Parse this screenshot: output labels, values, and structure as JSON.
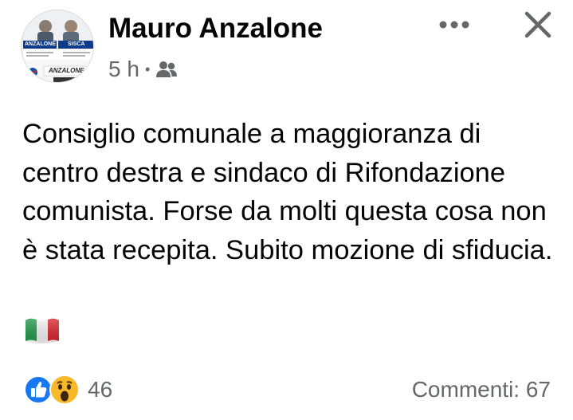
{
  "post": {
    "author": "Mauro Anzalone",
    "time": "5 h",
    "separator": "•",
    "audience_icon": "friends-icon",
    "text": "Consiglio comunale a maggioranza di centro destra e sindaco di Rifondazione comunista. Forse da molti questa cosa non è stata recepita. Subito mozione di sfiducia.",
    "emoji": "italy-flag"
  },
  "avatar": {
    "label_left": "ANZALONE",
    "label_right": "SISCA",
    "label_bottom": "ANZALONE"
  },
  "header_actions": {
    "more_icon": "more-dots-icon",
    "close_icon": "close-icon"
  },
  "footer": {
    "reaction_icons": [
      "like-icon",
      "wow-icon"
    ],
    "reaction_count": "46",
    "comments": "Commenti: 67"
  },
  "colors": {
    "text": "#050505",
    "secondary": "#65676b",
    "like_blue": "#1877f2",
    "wow_yellow": "#f7b928"
  }
}
